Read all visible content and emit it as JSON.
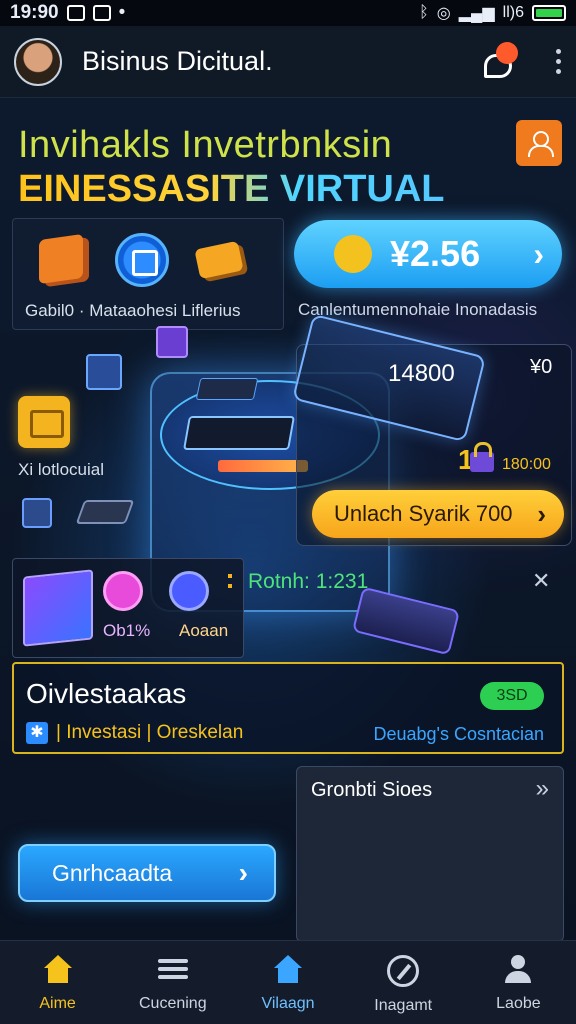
{
  "status_bar": {
    "time": "19:90",
    "network_label": "ll)6"
  },
  "header": {
    "title": "Bisinus Dicitual."
  },
  "hero": {
    "line1": "Invihakls Invetrbnksin",
    "line2": "EINESSASITE VIRTUAL"
  },
  "quick_tiles": {
    "label": "Gabil0 · Mataaohesi Liflerius"
  },
  "balance": {
    "value": "¥2.56",
    "caption": "Canlentumennohaie Inonadasis"
  },
  "side_feature": {
    "label": "Xi lotlocuial"
  },
  "offer": {
    "amount": "14800",
    "currency": "¥0",
    "prefix": "1",
    "tag": "180:00",
    "button_label": "Unlach Syarik 700"
  },
  "stats": {
    "label1": "Ob1%",
    "label2": "Aoaan",
    "ratio": "Rotnh: 1:231"
  },
  "investments": {
    "title": "Oivlestaakas",
    "badge": "3SD",
    "subtitle": "| Investasi | Oreskelan",
    "link": "Deuabg's Cosntacian"
  },
  "growth": {
    "title": "Gronbti Sioes"
  },
  "cta": {
    "label": "Gnrhcaadta"
  },
  "nav": {
    "items": [
      {
        "label": "Aime",
        "icon": "home-icon"
      },
      {
        "label": "Cucening",
        "icon": "list-icon"
      },
      {
        "label": "Vilaagn",
        "icon": "home-icon"
      },
      {
        "label": "Inagamt",
        "icon": "compass-icon"
      },
      {
        "label": "Laobe",
        "icon": "person-icon"
      }
    ]
  },
  "colors": {
    "accent_yellow": "#f6c21c",
    "accent_blue": "#1c9ef2",
    "success_green": "#2dcf52",
    "background": "#0b1424"
  }
}
